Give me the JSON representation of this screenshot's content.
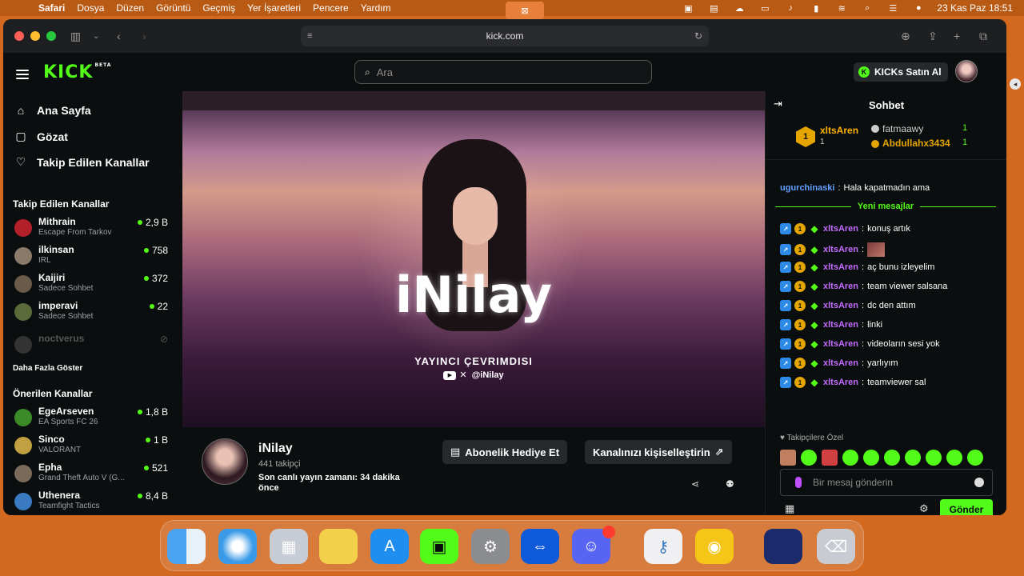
{
  "menubar": {
    "items": [
      "Safari",
      "Dosya",
      "Düzen",
      "Görüntü",
      "Geçmiş",
      "Yer İşaretleri",
      "Pencere",
      "Yardım"
    ],
    "datetime": "23 Kas Paz  18:51"
  },
  "browser": {
    "url": "kick.com"
  },
  "header": {
    "logo": "KICK",
    "logo_badge": "BETA",
    "search_placeholder": "Ara",
    "buy_button": "KICKs Satın Al"
  },
  "sidebar": {
    "nav": [
      {
        "label": "Ana Sayfa",
        "icon": "home-icon"
      },
      {
        "label": "Gözat",
        "icon": "browse-icon"
      },
      {
        "label": "Takip Edilen Kanallar",
        "icon": "heart-icon"
      }
    ],
    "followed_title": "Takip Edilen Kanallar",
    "followed": [
      {
        "name": "Mithrain",
        "category": "Escape From Tarkov",
        "viewers": "2,9 B",
        "avatar_color": "#b3202a"
      },
      {
        "name": "ilkinsan",
        "category": "IRL",
        "viewers": "758",
        "avatar_color": "#8a7a6a"
      },
      {
        "name": "Kaijiri",
        "category": "Sadece Sohbet",
        "viewers": "372",
        "avatar_color": "#6a5a4a"
      },
      {
        "name": "imperavi",
        "category": "Sadece Sohbet",
        "viewers": "22",
        "avatar_color": "#5a6a3a"
      },
      {
        "name": "noctverus",
        "category": "",
        "viewers": "",
        "avatar_color": "#333333"
      }
    ],
    "show_more": "Daha Fazla Göster",
    "recommended_title": "Önerilen Kanallar",
    "recommended": [
      {
        "name": "EgeArseven",
        "category": "EA Sports FC 26",
        "viewers": "1,8 B",
        "avatar_color": "#3a8a2a"
      },
      {
        "name": "Sinco",
        "category": "VALORANT",
        "viewers": "1 B",
        "avatar_color": "#c0a040"
      },
      {
        "name": "Epha",
        "category": "Grand Theft Auto V (G...",
        "viewers": "521",
        "avatar_color": "#7a6a5a"
      },
      {
        "name": "Uthenera",
        "category": "Teamfight Tactics",
        "viewers": "8,4 B",
        "avatar_color": "#3a7ac0"
      }
    ]
  },
  "video": {
    "title": "iNilay",
    "status": "YAYINCI ÇEVRIMDISI",
    "handle": "@iNilay"
  },
  "channel": {
    "name": "iNilay",
    "followers": "441 takipçi",
    "last_live": "Son canlı yayın zamanı: 34 dakika önce",
    "gift_button": "Abonelik Hediye Et",
    "customize_button": "Kanalınızı kişiselleştirin"
  },
  "chat": {
    "title": "Sohbet",
    "gifters": {
      "top": {
        "name": "xltsAren",
        "rank": "1",
        "count": "1"
      },
      "second": {
        "name": "fatmaawy",
        "count": "1"
      },
      "third": {
        "name": "Abdullahx3434",
        "count": "1"
      }
    },
    "prior": {
      "user": "ugurchinaski",
      "text": "Hala kapatmadın ama"
    },
    "new_messages": "Yeni mesajlar",
    "messages": [
      {
        "user": "xltsAren",
        "text": "konuş artık"
      },
      {
        "user": "xltsAren",
        "text": ""
      },
      {
        "user": "xltsAren",
        "text": "aç bunu izleyelim"
      },
      {
        "user": "xltsAren",
        "text": "team viewer salsana"
      },
      {
        "user": "xltsAren",
        "text": "dc den attım"
      },
      {
        "user": "xltsAren",
        "text": "linki"
      },
      {
        "user": "xltsAren",
        "text": "videoların sesi yok"
      },
      {
        "user": "xltsAren",
        "text": "yarlıyım"
      },
      {
        "user": "xltsAren",
        "text": "teamviewer sal"
      }
    ],
    "followers_only": "Takipçilere Özel",
    "input_placeholder": "Bir mesaj gönderin",
    "send": "Gönder"
  },
  "dock": {
    "apps": [
      "finder-icon",
      "safari-icon",
      "launchpad-icon",
      "notes-icon",
      "app-store-icon",
      "kick-app-icon",
      "system-settings-icon",
      "teamviewer-icon",
      "discord-icon",
      "keychain-icon",
      "tips-icon",
      "finder-window-icon",
      "trash-icon"
    ]
  }
}
